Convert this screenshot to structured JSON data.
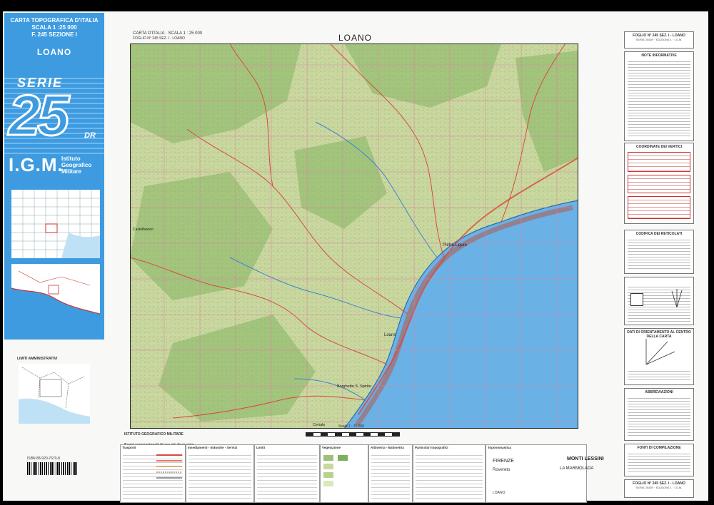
{
  "cover": {
    "header_line1": "CARTA TOPOGRAFICA D'ITALIA",
    "header_line2": "SCALA 1 :25 000",
    "header_line3": "F. 245 SEZIONE I",
    "sheet_name": "LOANO",
    "serie": "SERIE",
    "serie_number": "25",
    "unit": "DR",
    "igm": "I.G.M.",
    "institute_line1": "Istituto",
    "institute_line2": "Geografico",
    "institute_line3": "Militare",
    "limiti_title": "LIMITI AMMINISTRATIVI",
    "isbn": "ISBN 88-920-7670-8"
  },
  "map": {
    "header_line1": "CARTA D'ITALIA · SCALA 1 : 25 000",
    "header_line2": "FOGLIO N° 245 SEZ. I - LOANO",
    "title": "LOANO",
    "places": {
      "loano": "Loano",
      "pietra": "Pietra Ligure",
      "borghetto": "Borghetto S. Spirito",
      "ceriale": "Ceriale",
      "castelbianco": "Castelbianco"
    },
    "scale_caption": "Scala 1 : 25 000",
    "institute_caption": "ISTITUTO GEOGRAFICO MILITARE",
    "signs_caption": "Segni convenzionali di uso più frequente",
    "colors": {
      "terrain": "#c9d8a0",
      "forest": "#9cc278",
      "sea": "#6ab2e6",
      "road": "#d84a3a",
      "grid": "#e07da0"
    }
  },
  "legend": {
    "p1": "Trasporti",
    "p2": "Insediamenti - Industrie - Servizi",
    "p3": "Limiti",
    "p4": "Vegetazione",
    "p5": "Altimetria - Batimetria",
    "p6": "Particolari topografici",
    "p7": "Toponomastica"
  },
  "toponymy": {
    "firenze": "FIRENZE",
    "monti": "MONTI LESSINI",
    "rovereto": "Rovereto",
    "marmolada": "LA MARMOLADA",
    "loano_small": "LOANO"
  },
  "right": {
    "box1": "FOGLIO N° 245 SEZ. I - LOANO",
    "box1_sub": "SERIE 25/DR · EDIZIONE 1 · I.G.M.",
    "box2": "NOTE INFORMATIVE",
    "box3": "COORDINATE DEI VERTICI",
    "box4": "CODIFICA DEI RETICOLATI",
    "box5": "DATI DI ORIENTAMENTO AL CENTRO DELLA CARTA",
    "box6": "ABBREVIAZIONI",
    "box7": "FONTI DI COMPILAZIONE",
    "footer1": "FOGLIO N° 245 SEZ. I - LOANO",
    "footer2": "SERIE 25/DR · EDIZIONE 1 · I.G.M."
  }
}
